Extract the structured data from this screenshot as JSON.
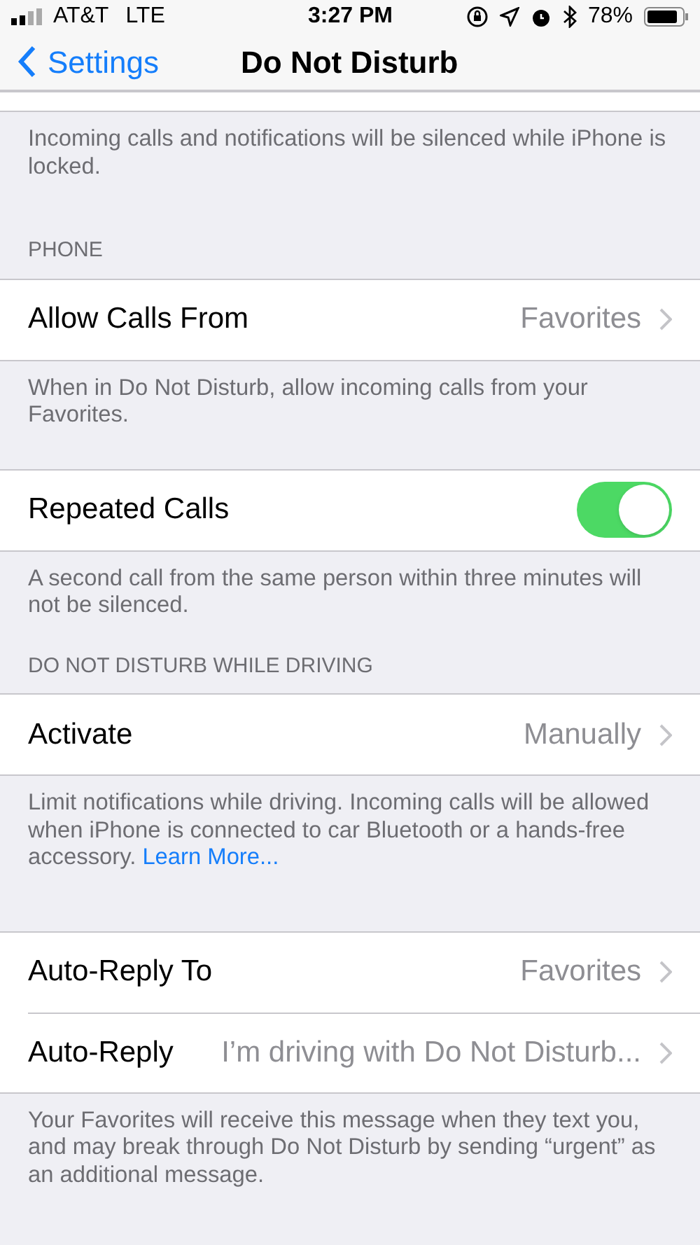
{
  "status_bar": {
    "carrier": "AT&T",
    "network": "LTE",
    "time": "3:27 PM",
    "battery": "78%"
  },
  "nav": {
    "back": "Settings",
    "title": "Do Not Disturb"
  },
  "blocks": [
    {
      "kind": "blank"
    },
    {
      "kind": "footer",
      "text": "Incoming calls and notifications will be silenced while iPhone is locked."
    },
    {
      "kind": "header",
      "text": "PHONE"
    },
    {
      "kind": "link",
      "label": "Allow Calls From",
      "value": "Favorites"
    },
    {
      "kind": "footer",
      "text": "When in Do Not Disturb, allow incoming calls from your Favorites."
    },
    {
      "kind": "toggle",
      "label": "Repeated Calls",
      "on": true
    },
    {
      "kind": "footer",
      "text": "A second call from the same person within three minutes will not be silenced."
    },
    {
      "kind": "header",
      "text": "DO NOT DISTURB WHILE DRIVING"
    },
    {
      "kind": "link",
      "label": "Activate",
      "value": "Manually"
    },
    {
      "kind": "footer",
      "text": "Limit notifications while driving. Incoming calls will be allowed when iPhone is connected to car Bluetooth or a hands-free accessory.",
      "link": "Learn More..."
    },
    {
      "kind": "link",
      "label": "Auto-Reply To",
      "value": "Favorites"
    },
    {
      "kind": "link",
      "label": "Auto-Reply",
      "value": "I’m driving with Do Not Disturb..."
    },
    {
      "kind": "footer",
      "text": "Your Favorites will receive this message when they text you, and may break through Do Not Disturb by sending “urgent” as an additional message."
    }
  ]
}
